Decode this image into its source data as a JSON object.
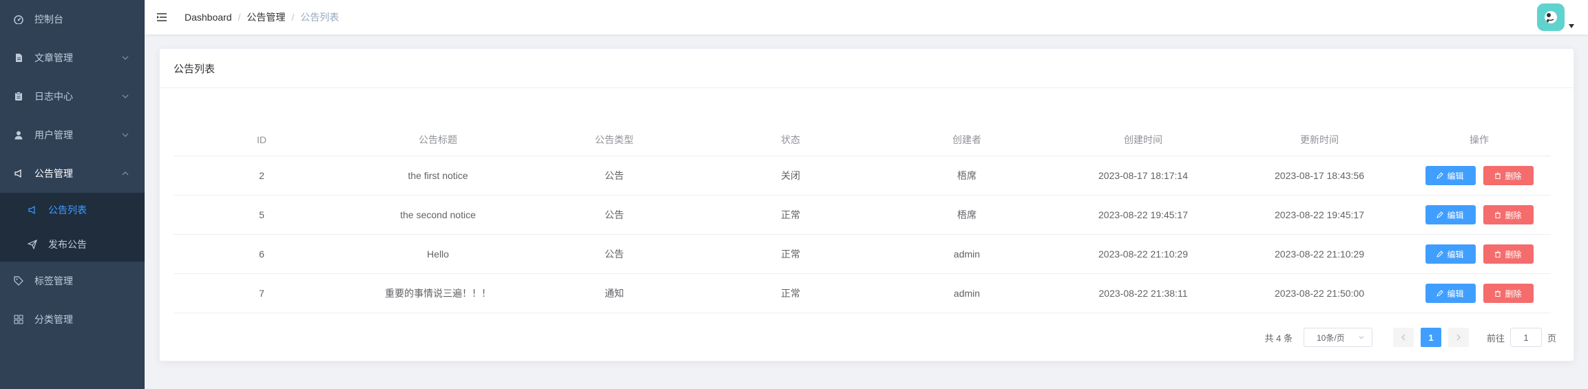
{
  "sidebar": {
    "bg_color": "#304156",
    "active_color": "#409eff",
    "items": [
      {
        "label": "控制台",
        "icon": "dashboard-icon"
      },
      {
        "label": "文章管理",
        "icon": "document-icon"
      },
      {
        "label": "日志中心",
        "icon": "log-icon"
      },
      {
        "label": "用户管理",
        "icon": "user-icon"
      },
      {
        "label": "公告管理",
        "icon": "megaphone-icon"
      },
      {
        "label": "标签管理",
        "icon": "tag-icon"
      },
      {
        "label": "分类管理",
        "icon": "grid-icon"
      }
    ],
    "submenu": [
      {
        "label": "公告列表",
        "icon": "megaphone-icon"
      },
      {
        "label": "发布公告",
        "icon": "send-icon"
      }
    ]
  },
  "header": {
    "breadcrumb": [
      "Dashboard",
      "公告管理",
      "公告列表"
    ]
  },
  "card": {
    "title": "公告列表"
  },
  "table": {
    "columns": [
      "ID",
      "公告标题",
      "公告类型",
      "状态",
      "创建者",
      "创建时间",
      "更新时间",
      "操作"
    ],
    "rows": [
      {
        "id": "2",
        "title": "the first notice",
        "type": "公告",
        "status": "关闭",
        "creator": "梧席",
        "created": "2023-08-17 18:17:14",
        "updated": "2023-08-17 18:43:56"
      },
      {
        "id": "5",
        "title": "the second notice",
        "type": "公告",
        "status": "正常",
        "creator": "梧席",
        "created": "2023-08-22 19:45:17",
        "updated": "2023-08-22 19:45:17"
      },
      {
        "id": "6",
        "title": "Hello",
        "type": "公告",
        "status": "正常",
        "creator": "admin",
        "created": "2023-08-22 21:10:29",
        "updated": "2023-08-22 21:10:29"
      },
      {
        "id": "7",
        "title": "重要的事情说三遍！！！",
        "type": "通知",
        "status": "正常",
        "creator": "admin",
        "created": "2023-08-22 21:38:11",
        "updated": "2023-08-22 21:50:00"
      }
    ],
    "edit_label": "编辑",
    "delete_label": "删除"
  },
  "pagination": {
    "total": "共 4 条",
    "page_size": "10条/页",
    "current_page": "1",
    "goto_prefix": "前往",
    "goto_value": "1",
    "goto_suffix": "页"
  }
}
